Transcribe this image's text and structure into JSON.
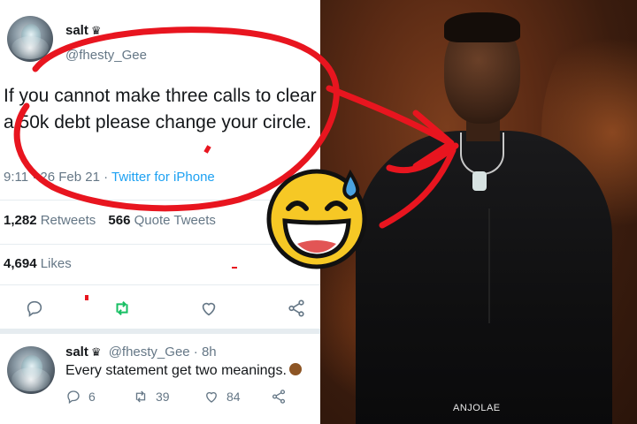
{
  "tweet": {
    "display_name": "salt",
    "badge": "♛",
    "handle": "@fhesty_Gee",
    "text": "If you cannot make three calls to clear a 50k debt please change your circle.",
    "time": "9:11 · 26 Feb 21 ·",
    "client": "Twitter for iPhone",
    "retweets_count": "1,282",
    "retweets_label": "Retweets",
    "quote_count": "566",
    "quote_label": "Quote Tweets",
    "likes_count": "4,694",
    "likes_label": "Likes",
    "actions": [
      "reply-icon",
      "retweet-icon",
      "like-icon",
      "share-icon"
    ]
  },
  "reply": {
    "display_name": "salt",
    "badge": "♛",
    "handle_time": "@fhesty_Gee · 8h",
    "text": "Every statement get two meanings.",
    "reply_count": "6",
    "retweet_count": "39",
    "like_count": "84"
  },
  "photo": {
    "credit": "ANJOLAE"
  },
  "overlay": {
    "emoji": "grinning-face-with-sweat-emoji",
    "annotation_color": "#e8151f"
  },
  "colors": {
    "twitter_blue": "#1da1f2",
    "retweet_green": "#17bf63",
    "muted_gray": "#657786"
  }
}
